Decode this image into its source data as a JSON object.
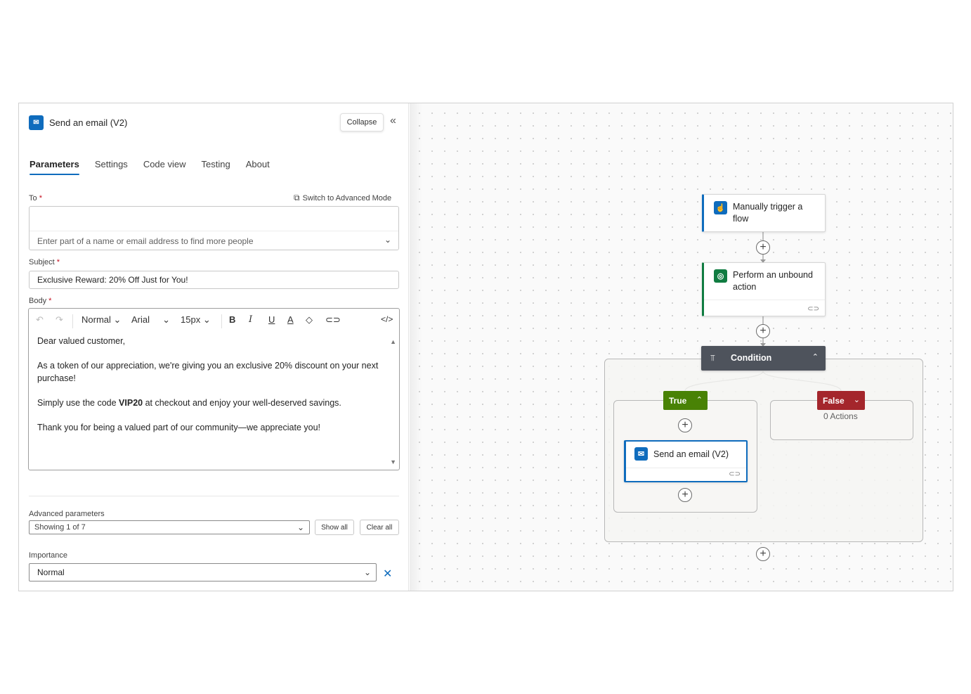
{
  "panel": {
    "app_icon": "outlook-icon",
    "title": "Send an email (V2)",
    "collapse_label": "Collapse",
    "collapse_icon": "double-chevron-left-icon",
    "tabs": [
      {
        "label": "Parameters",
        "active": true
      },
      {
        "label": "Settings",
        "active": false
      },
      {
        "label": "Code view",
        "active": false
      },
      {
        "label": "Testing",
        "active": false
      },
      {
        "label": "About",
        "active": false
      }
    ],
    "to_label": "To",
    "required_mark": "*",
    "switch_advanced_label": "Switch to Advanced Mode",
    "to_placeholder": "Enter part of a name or email address to find more people",
    "subject_label": "Subject",
    "subject_value": "Exclusive Reward: 20% Off Just for You!",
    "body_label": "Body",
    "toolbar": {
      "style": "Normal",
      "font": "Arial",
      "size": "15px",
      "undo_icon": "undo-icon",
      "redo_icon": "redo-icon",
      "bold": "B",
      "italic": "I",
      "underline": "U",
      "font_color_icon": "font-color-icon",
      "highlight_icon": "paint-bucket-icon",
      "link_icon": "link-icon",
      "code_icon": "code-view-icon"
    },
    "body": {
      "line1": "Dear valued customer,",
      "line2": "As a token of our appreciation, we're giving you an exclusive 20% discount on your next purchase!",
      "line3_before": "Simply use the code ",
      "line3_code": "VIP20",
      "line3_after": " at checkout and enjoy your well-deserved savings.",
      "line4": "Thank you for being a valued part of our community—we appreciate you!"
    },
    "advanced_label": "Advanced parameters",
    "advanced_value": "Showing 1 of 7",
    "show_all": "Show all",
    "clear_all": "Clear all",
    "importance_label": "Importance",
    "importance_value": "Normal"
  },
  "canvas": {
    "trigger": {
      "title": "Manually trigger a flow",
      "icon": "trigger-hand-icon",
      "accent": "#0f6cbd"
    },
    "action": {
      "title": "Perform an unbound action",
      "icon": "dataverse-icon",
      "accent": "#107c41"
    },
    "condition": {
      "title": "Condition",
      "icon": "condition-icon",
      "bg": "#4e535c"
    },
    "true_branch": {
      "label": "True",
      "color": "#498205"
    },
    "false_branch": {
      "label": "False",
      "color": "#a4262c",
      "empty_text": "0 Actions"
    },
    "email_action": {
      "title": "Send an email (V2)",
      "icon": "outlook-icon",
      "accent": "#0f6cbd"
    },
    "plus_symbol": "+"
  }
}
